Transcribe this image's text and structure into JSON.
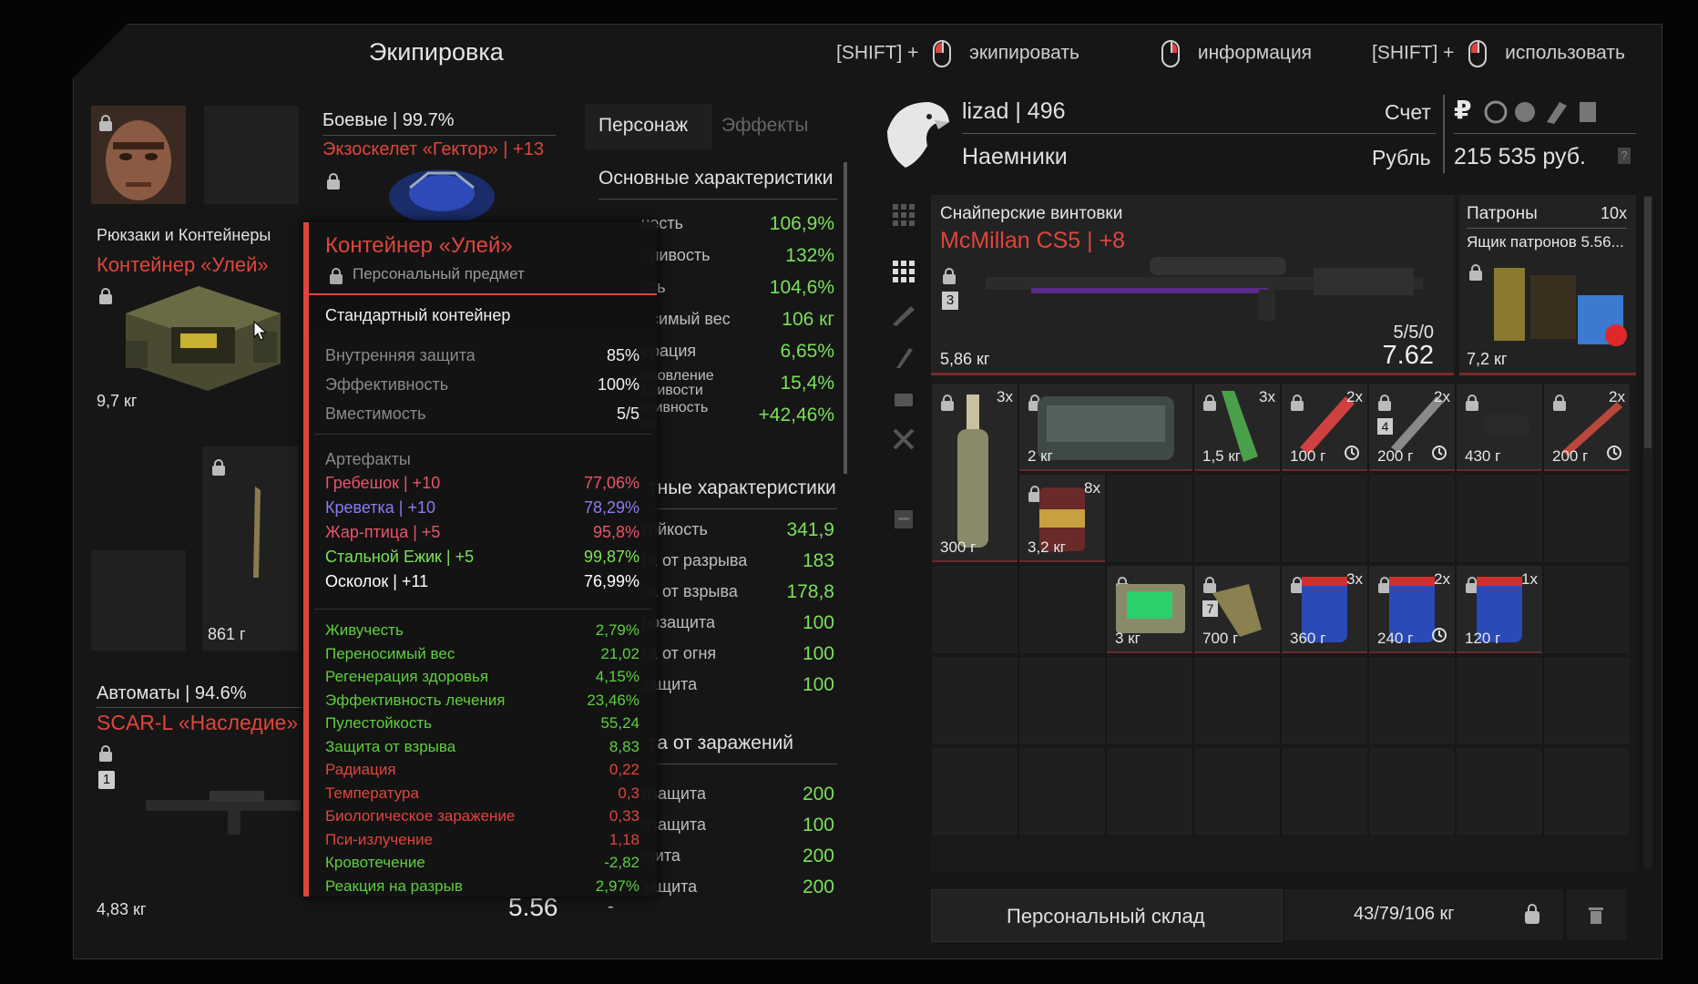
{
  "header": {
    "title": "Экипировка",
    "hint_equip_key": "[SHIFT] +",
    "hint_equip": "экипировать",
    "hint_info": "информация",
    "hint_use_key": "[SHIFT] +",
    "hint_use": "использовать"
  },
  "character": {
    "combat_label": "Боевые | 99.7%",
    "armor_name": "Экзоскелет «Гектор» | +13",
    "backpack_section": "Рюкзаки и Контейнеры",
    "container_name": "Контейнер «Улей»",
    "container_weight": "9,7 кг",
    "melee_weight": "861 г",
    "rifles_label": "Автоматы | 94.6%",
    "rifle_name": "SCAR-L «Наследие»",
    "rifle_weight": "4,83 кг",
    "rifle_slot": "1",
    "rifle_caliber": "5.56"
  },
  "tooltip": {
    "name": "Контейнер «Улей»",
    "personal": "Персональный предмет",
    "type": "Стандартный контейнер",
    "props": [
      {
        "label": "Внутренняя защита",
        "value": "85%"
      },
      {
        "label": "Эффективность",
        "value": "100%"
      },
      {
        "label": "Вместимость",
        "value": "5/5"
      }
    ],
    "artifacts_label": "Артефакты",
    "artifacts": [
      {
        "label": "Гребешок | +10",
        "value": "77,06%",
        "color": "#e8556b"
      },
      {
        "label": "Креветка | +10",
        "value": "78,29%",
        "color": "#8a7df0"
      },
      {
        "label": "Жар-птица | +5",
        "value": "95,8%",
        "color": "#e8556b"
      },
      {
        "label": "Стальной Ежик | +5",
        "value": "99,87%",
        "color": "#7be05a"
      },
      {
        "label": "Осколок | +11",
        "value": "76,99%",
        "color": "#ffffff"
      }
    ],
    "effects": [
      {
        "label": "Живучесть",
        "value": "2,79%",
        "color": "#5ecf3e"
      },
      {
        "label": "Переносимый вес",
        "value": "21,02",
        "color": "#5ecf3e"
      },
      {
        "label": "Регенерация здоровья",
        "value": "4,15%",
        "color": "#5ecf3e"
      },
      {
        "label": "Эффективность лечения",
        "value": "23,46%",
        "color": "#5ecf3e"
      },
      {
        "label": "Пулестойкость",
        "value": "55,24",
        "color": "#5ecf3e"
      },
      {
        "label": "Защита от взрыва",
        "value": "8,83",
        "color": "#5ecf3e"
      },
      {
        "label": "Радиация",
        "value": "0,22",
        "color": "#e0453c"
      },
      {
        "label": "Температура",
        "value": "0,3",
        "color": "#e0453c"
      },
      {
        "label": "Биологическое заражение",
        "value": "0,33",
        "color": "#e0453c"
      },
      {
        "label": "Пси-излучение",
        "value": "1,18",
        "color": "#e0453c"
      },
      {
        "label": "Кровотечение",
        "value": "-2,82",
        "color": "#5ecf3e"
      },
      {
        "label": "Реакция на разрыв",
        "value": "2,97%",
        "color": "#5ecf3e"
      }
    ]
  },
  "stats": {
    "tab_character": "Персонаж",
    "tab_effects": "Эффекты",
    "main_header": "Основные характеристики",
    "main": [
      {
        "label": "честь",
        "value": "106,9%"
      },
      {
        "label": "сливость",
        "value": "132%"
      },
      {
        "label": "сть",
        "value": "104,6%"
      },
      {
        "label": "осимый вес",
        "value": "106 кг"
      },
      {
        "label": "ерация",
        "value": "6,65%"
      },
      {
        "label": "ановление\nсливости",
        "value": "15,4%"
      },
      {
        "label": "ктивность\nия",
        "value": "+42,46%"
      }
    ],
    "protect_header": "тные характеристики",
    "protect": [
      {
        "label": "тойкость",
        "value": "341,9"
      },
      {
        "label": "та от разрыва",
        "value": "183"
      },
      {
        "label": "та от взрыва",
        "value": "178,8"
      },
      {
        "label": "розащита",
        "value": "100"
      },
      {
        "label": "та от огня",
        "value": "100"
      },
      {
        "label": "защита",
        "value": "100"
      }
    ],
    "infect_header": "та от заражений",
    "infect": [
      {
        "label": "озащита",
        "value": "200"
      },
      {
        "label": "озащита",
        "value": "100"
      },
      {
        "label": "щита",
        "value": "200"
      },
      {
        "label": "защита",
        "value": "200"
      }
    ],
    "footer_value": "-"
  },
  "player": {
    "name": "lizad | 496",
    "faction": "Наемники",
    "account_label": "Счет",
    "currency_label": "Рубль",
    "balance": "215 535 руб.",
    "help": "?",
    "ruble_symbol": "₽"
  },
  "inventory": {
    "weapon_category": "Снайперские винтовки",
    "weapon_name": "McMillan CS5 | +8",
    "weapon_slot": "3",
    "weapon_weight": "5,86 кг",
    "weapon_ammo": "5/5/0",
    "weapon_caliber": "7.62",
    "ammo_category": "Патроны",
    "ammo_count": "10x",
    "ammo_name": "Ящик патронов 5.56...",
    "ammo_weight": "7,2 кг",
    "row1": [
      {
        "w": "300 г",
        "q": "3x"
      },
      {
        "w": "2 кг",
        "q": ""
      },
      {
        "w": "1,5 кг",
        "q": "3x"
      },
      {
        "w": "100 г",
        "q": "2x"
      },
      {
        "w": "200 г",
        "q": "2x",
        "slot": "4"
      },
      {
        "w": "430 г",
        "q": ""
      },
      {
        "w": "200 г",
        "q": "2x"
      }
    ],
    "row2": [
      {
        "w": "3,2 кг",
        "q": "8x"
      }
    ],
    "row3": [
      {
        "w": "3 кг",
        "q": ""
      },
      {
        "w": "700 г",
        "q": "",
        "slot": "7"
      },
      {
        "w": "360 г",
        "q": "3x"
      },
      {
        "w": "240 г",
        "q": "2x"
      },
      {
        "w": "120 г",
        "q": "1x"
      }
    ],
    "storage_button": "Персональный склад",
    "capacity": "43/79/106 кг"
  },
  "colors": {
    "accent_red": "#e0453c",
    "stat_green": "#7be05a",
    "panel_bg": "#1c1c1c"
  }
}
